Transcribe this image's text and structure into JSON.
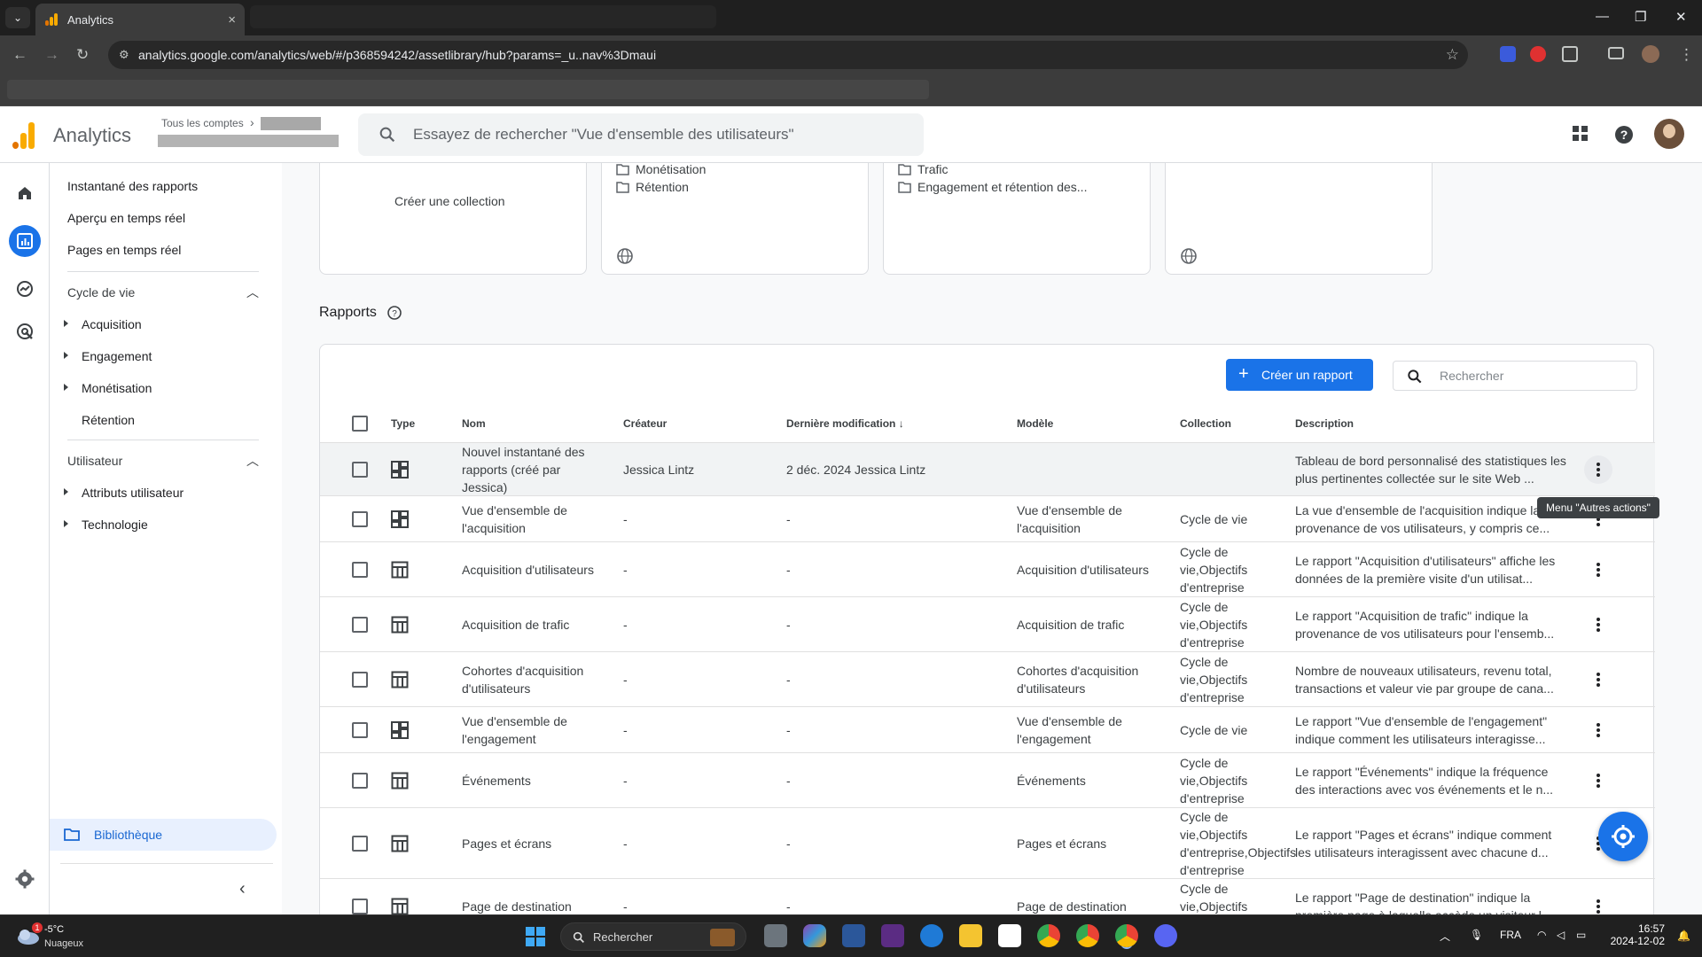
{
  "browser": {
    "tab_title": "Analytics",
    "tab_close": "×",
    "url": "analytics.google.com/analytics/web/#/p368594242/assetlibrary/hub?params=_u..nav%3Dmaui"
  },
  "header": {
    "product": "Analytics",
    "account_label": "Tous les comptes",
    "search_placeholder": "Essayez de rechercher \"Vue d'ensemble des utilisateurs\""
  },
  "sidenav": {
    "top_items": [
      "Instantané des rapports",
      "Aperçu en temps réel",
      "Pages en temps réel"
    ],
    "lifecycle": {
      "title": "Cycle de vie",
      "items": [
        "Acquisition",
        "Engagement",
        "Monétisation",
        "Rétention"
      ]
    },
    "user": {
      "title": "Utilisateur",
      "items": [
        "Attributs utilisateur",
        "Technologie"
      ]
    },
    "library": "Bibliothèque"
  },
  "collections": {
    "create_label": "Créer une collection",
    "card2": [
      "Monétisation",
      "Rétention"
    ],
    "card3": [
      "Trafic",
      "Engagement et rétention des..."
    ]
  },
  "reports": {
    "title": "Rapports",
    "create_button": "Créer un rapport",
    "search_placeholder": "Rechercher",
    "columns": {
      "type": "Type",
      "name": "Nom",
      "creator": "Créateur",
      "modified": "Dernière modification",
      "template": "Modèle",
      "collection": "Collection",
      "description": "Description"
    },
    "rows": [
      {
        "type": "dashboard",
        "name": "Nouvel instantané des rapports (créé par Jessica)",
        "creator": "Jessica Lintz",
        "modified": "2 déc. 2024 Jessica Lintz",
        "template": "",
        "collection": "",
        "description": "Tableau de bord personnalisé des statistiques les plus pertinentes collectée sur le site Web ..."
      },
      {
        "type": "dashboard",
        "name": "Vue d'ensemble de l'acquisition",
        "creator": "-",
        "modified": "-",
        "template": "Vue d'ensemble de l'acquisition",
        "collection": "Cycle de vie",
        "description": "La vue d'ensemble de l'acquisition indique la provenance de vos utilisateurs, y compris ce..."
      },
      {
        "type": "table",
        "name": "Acquisition d'utilisateurs",
        "creator": "-",
        "modified": "-",
        "template": "Acquisition d'utilisateurs",
        "collection": "Cycle de vie,Objectifs d'entreprise",
        "description": "Le rapport \"Acquisition d'utilisateurs\" affiche les données de la première visite d'un utilisat..."
      },
      {
        "type": "table",
        "name": "Acquisition de trafic",
        "creator": "-",
        "modified": "-",
        "template": "Acquisition de trafic",
        "collection": "Cycle de vie,Objectifs d'entreprise",
        "description": "Le rapport \"Acquisition de trafic\" indique la provenance de vos utilisateurs pour l'ensemb..."
      },
      {
        "type": "table",
        "name": "Cohortes d'acquisition d'utilisateurs",
        "creator": "-",
        "modified": "-",
        "template": "Cohortes d'acquisition d'utilisateurs",
        "collection": "Cycle de vie,Objectifs d'entreprise",
        "description": "Nombre de nouveaux utilisateurs, revenu total, transactions et valeur vie par groupe de cana..."
      },
      {
        "type": "dashboard",
        "name": "Vue d'ensemble de l'engagement",
        "creator": "-",
        "modified": "-",
        "template": "Vue d'ensemble de l'engagement",
        "collection": "Cycle de vie",
        "description": "Le rapport \"Vue d'ensemble de l'engagement\" indique comment les utilisateurs interagisse..."
      },
      {
        "type": "table",
        "name": "Événements",
        "creator": "-",
        "modified": "-",
        "template": "Événements",
        "collection": "Cycle de vie,Objectifs d'entreprise",
        "description": "Le rapport \"Événements\" indique la fréquence des interactions avec vos événements et le n..."
      },
      {
        "type": "table",
        "name": "Pages et écrans",
        "creator": "-",
        "modified": "-",
        "template": "Pages et écrans",
        "collection": "Cycle de vie,Objectifs d'entreprise,Objectifs d'entreprise",
        "description": "Le rapport \"Pages et écrans\" indique comment les utilisateurs interagissent avec chacune d..."
      },
      {
        "type": "table",
        "name": "Page de destination",
        "creator": "-",
        "modified": "-",
        "template": "Page de destination",
        "collection": "Cycle de vie,Objectifs d'entreprise",
        "description": "Le rapport \"Page de destination\" indique la première page à laquelle accède un visiteur l..."
      }
    ]
  },
  "tooltip": "Menu \"Autres actions\"",
  "taskbar": {
    "temperature": "-5°C",
    "condition": "Nuageux",
    "weather_badge": "1",
    "search": "Rechercher",
    "language": "FRA",
    "time": "16:57",
    "date": "2024-12-02"
  },
  "colors": {
    "accent": "#1a73e8",
    "selected_nav_bg": "#e8f0fe",
    "logo_orange": "#f9ab00",
    "logo_dark_orange": "#e37400"
  }
}
